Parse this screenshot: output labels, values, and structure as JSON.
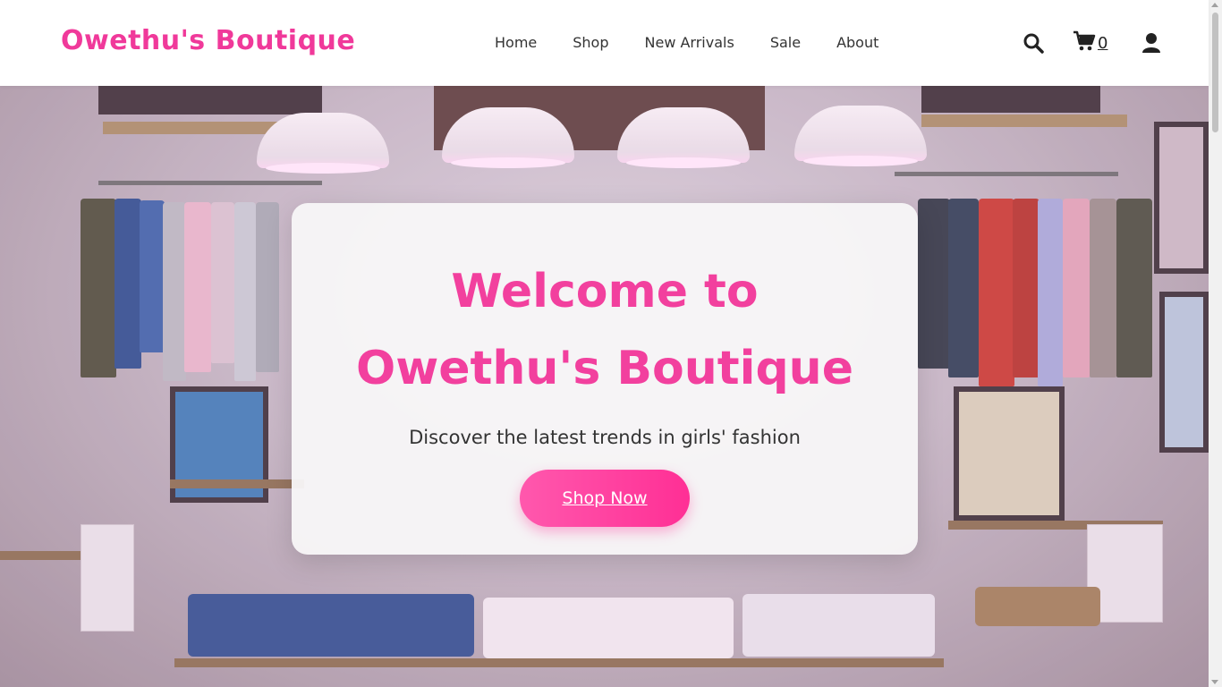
{
  "header": {
    "logo": "Owethu's Boutique",
    "nav": [
      {
        "label": "Home"
      },
      {
        "label": "Shop"
      },
      {
        "label": "New Arrivals"
      },
      {
        "label": "Sale"
      },
      {
        "label": "About"
      }
    ],
    "icons": {
      "search": "search-icon",
      "cart": "cart-icon",
      "user": "user-icon"
    },
    "cart_count": "0"
  },
  "hero": {
    "title_line1": "Welcome to",
    "title_line2": "Owethu's Boutique",
    "subtitle": "Discover the latest trends in girls' fashion",
    "cta_label": "Shop Now"
  },
  "colors": {
    "brand_pink": "#f0399a",
    "button_gradient_start": "#ff58ad",
    "button_gradient_end": "#ff2f95"
  }
}
